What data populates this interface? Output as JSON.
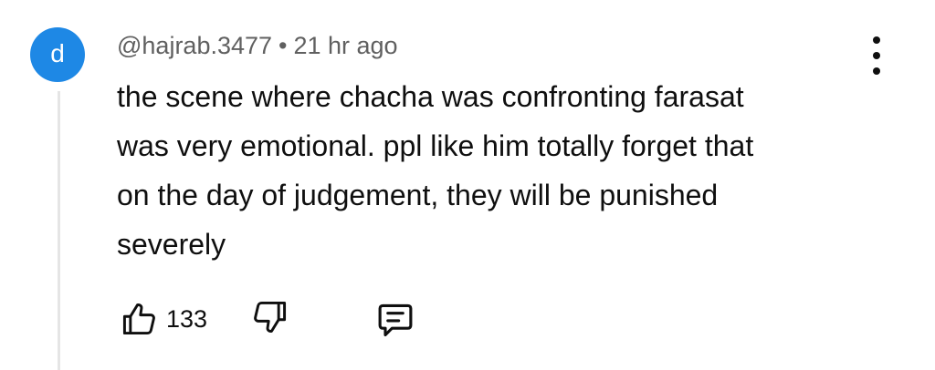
{
  "comment": {
    "avatar_letter": "d",
    "avatar_color": "#1e88e5",
    "author": "@hajrab.3477",
    "separator": "•",
    "time": "21 hr ago",
    "text_lines": [
      "the scene where chacha was confronting farasat",
      "was very emotional. ppl like him totally forget that",
      "on the day of judgement, they will be punished",
      "severely"
    ],
    "like_count": "133",
    "icons": {
      "more": "more-vertical-icon",
      "like": "thumbs-up-icon",
      "dislike": "thumbs-down-icon",
      "reply": "comment-reply-icon"
    }
  }
}
